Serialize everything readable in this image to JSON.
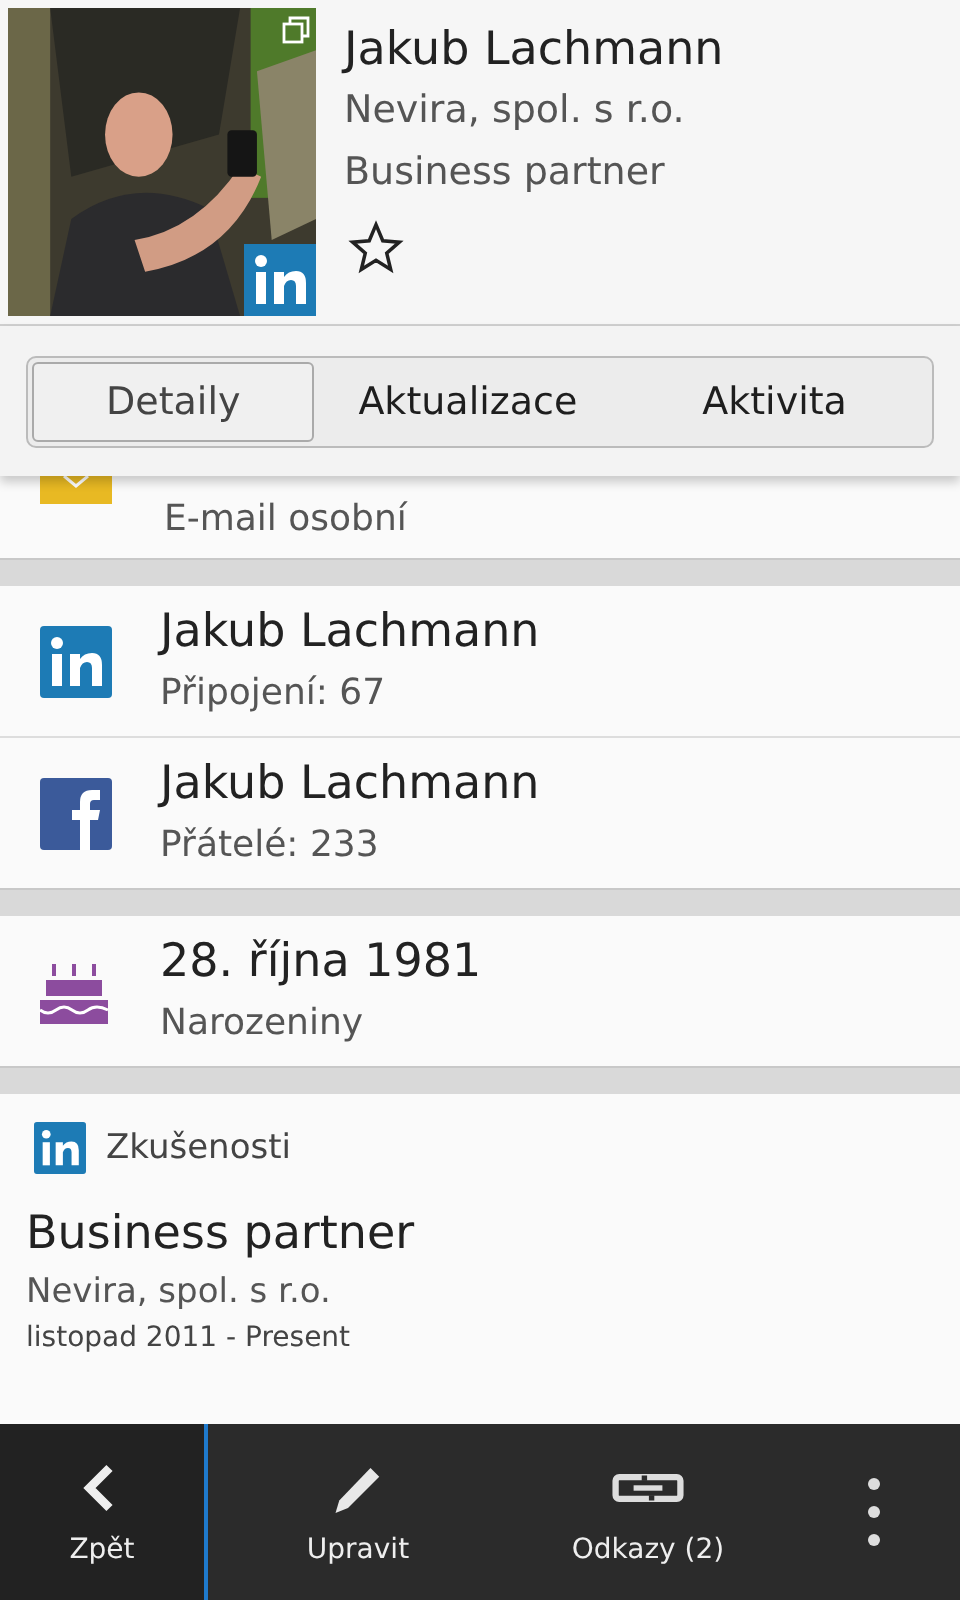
{
  "header": {
    "name": "Jakub Lachmann",
    "company": "Nevira, spol. s r.o.",
    "title": "Business partner",
    "favorite": false
  },
  "tabs": [
    {
      "label": "Detaily",
      "selected": true
    },
    {
      "label": "Aktualizace",
      "selected": false
    },
    {
      "label": "Aktivita",
      "selected": false
    }
  ],
  "email": {
    "label": "E-mail osobní"
  },
  "social": [
    {
      "kind": "linkedin",
      "name": "Jakub Lachmann",
      "detail": "Připojení: 67"
    },
    {
      "kind": "facebook",
      "name": "Jakub Lachmann",
      "detail": "Přátelé: 233"
    }
  ],
  "birthday": {
    "date": "28. října 1981",
    "label": "Narozeniny"
  },
  "experience": {
    "heading": "Zkušenosti",
    "position": "Business partner",
    "company": "Nevira, spol. s r.o.",
    "period": "listopad 2011 - Present"
  },
  "action_bar": [
    {
      "kind": "back",
      "label": "Zpět"
    },
    {
      "kind": "edit",
      "label": "Upravit"
    },
    {
      "kind": "links",
      "label": "Odkazy (2)"
    },
    {
      "kind": "more"
    }
  ]
}
